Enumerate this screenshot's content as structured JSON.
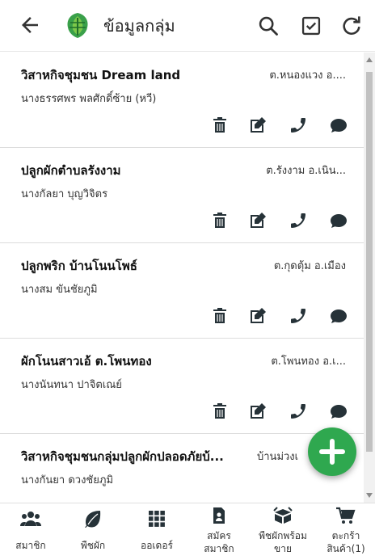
{
  "header": {
    "title": "ข้อมูลกลุ่ม"
  },
  "groups": [
    {
      "name": "วิสาหกิจชุมชน Dream land",
      "location": "ต.หนองแวง อ....",
      "contact": "นางธรรศพร พลศักดิ์ซ้าย (หวี)"
    },
    {
      "name": "ปลูกผักตำบลรังงาม",
      "location": "ต.รังงาม อ.เนิน...",
      "contact": "นางกัลยา บุญวิจิตร"
    },
    {
      "name": "ปลูกพริก บ้านโนนโพธ์",
      "location": "ต.กุดตุ้ม อ.เมือง",
      "contact": "นางสม ขันชัยภูมิ"
    },
    {
      "name": "ผักโนนสาวเอ้ ต.โพนทอง",
      "location": "ต.โพนทอง อ.เ...",
      "contact": "นางนันทนา ปาจิตเณย์"
    },
    {
      "name": "วิสาหกิจชุมชนกลุ่มปลูกผักปลอดภัยบ้...",
      "location": "บ้านม่วงเ",
      "contact": "นางกันยา ดวงชัยภูมิ"
    }
  ],
  "bottom_nav": [
    {
      "label_line1": "สมาชิก",
      "label_line2": "",
      "icon": "users-icon"
    },
    {
      "label_line1": "พืชผัก",
      "label_line2": "",
      "icon": "leaf-icon"
    },
    {
      "label_line1": "ออเดอร์",
      "label_line2": "",
      "icon": "grid-icon"
    },
    {
      "label_line1": "สมัคร",
      "label_line2": "สมาชิก",
      "icon": "register-icon"
    },
    {
      "label_line1": "พืชผักพร้อม",
      "label_line2": "ขาย",
      "icon": "box-icon"
    },
    {
      "label_line1": "ตะกร้า",
      "label_line2": "สินค้า(1)",
      "icon": "cart-icon"
    }
  ],
  "colors": {
    "accent_green": "#2fa84f",
    "logo_green": "#3aa04a",
    "icon_dark": "#263238"
  }
}
